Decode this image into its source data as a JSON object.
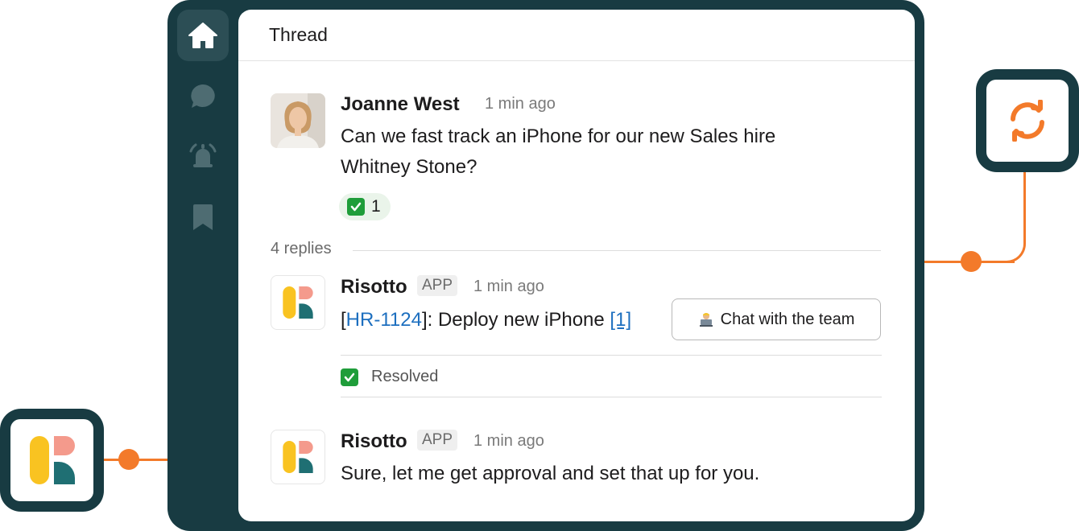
{
  "colors": {
    "accent": "#f37a2a",
    "frame": "#183b42",
    "link": "#1d6fbf",
    "check": "#1f9d3a"
  },
  "rail": {
    "items": [
      "home-icon",
      "chat-bubble-icon",
      "alarm-bell-icon",
      "bookmark-icon"
    ],
    "active": "home-icon"
  },
  "thread": {
    "title": "Thread"
  },
  "messages": {
    "first": {
      "author": "Joanne West",
      "time": "1 min ago",
      "text_line1": "Can we fast track an iPhone for our new Sales hire",
      "text_line2": "Whitney Stone?",
      "reaction_emoji": "✅",
      "reaction_count": "1"
    },
    "replies_label": "4 replies",
    "second": {
      "author": "Risotto",
      "badge": "APP",
      "time": "1 min ago",
      "ticket_open": "[",
      "ticket": "HR-1124",
      "ticket_close": "]",
      "text": ": Deploy new iPhone ",
      "ref": "[1]",
      "button_label": "Chat with the team",
      "status": "Resolved"
    },
    "third": {
      "author": "Risotto",
      "badge": "APP",
      "time": "1 min ago",
      "text": "Sure, let me get approval and set that up for you."
    }
  }
}
